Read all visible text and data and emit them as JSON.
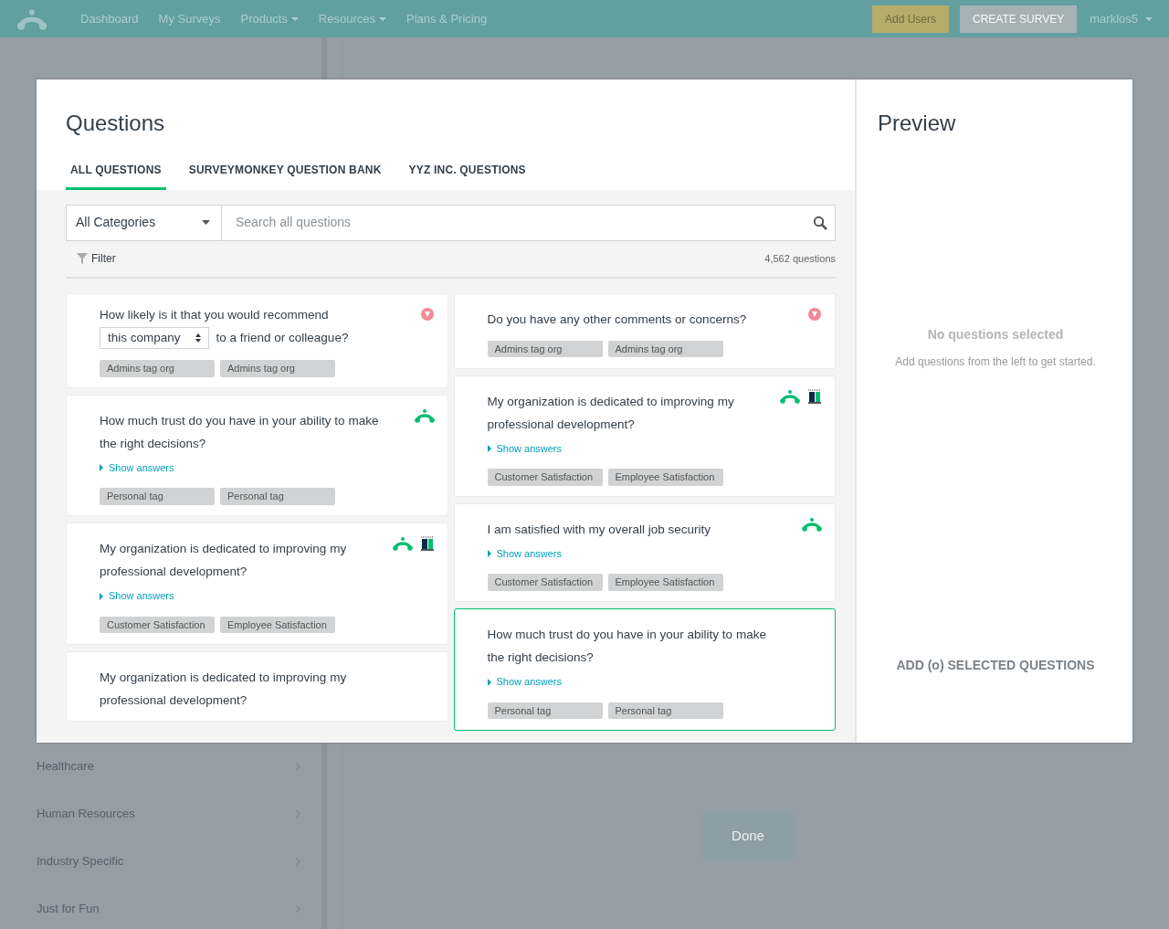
{
  "navbar": {
    "links": [
      {
        "label": "Dashboard",
        "dropdown": false
      },
      {
        "label": "My Surveys",
        "dropdown": false
      },
      {
        "label": "Products",
        "dropdown": true
      },
      {
        "label": "Resources",
        "dropdown": true
      },
      {
        "label": "Plans & Pricing",
        "dropdown": false
      }
    ],
    "add_users": "Add Users",
    "create_survey": "CREATE SURVEY",
    "user": "marklos5"
  },
  "background": {
    "categories": [
      "Healthcare",
      "Human Resources",
      "Industry Specific",
      "Just for Fun"
    ],
    "done": "Done"
  },
  "modal": {
    "title": "Questions",
    "tabs": [
      {
        "label": "ALL QUESTIONS",
        "selected": true
      },
      {
        "label": "SURVEYMONKEY QUESTION BANK",
        "selected": false
      },
      {
        "label": "YYZ INC. QUESTIONS",
        "selected": false
      }
    ],
    "category": "All Categories",
    "search": {
      "placeholder": "Search all questions"
    },
    "filter": "Filter",
    "count": "4,562 questions",
    "columns": [
      [
        {
          "kind": "org",
          "selected": false,
          "text": "How likely is it that you would recommend",
          "dropdown": "this company",
          "text_after": "to a friend or colleague?",
          "tags": [
            "Admins tag org",
            "Admins tag org"
          ]
        },
        {
          "kind": "bank",
          "selected": false,
          "text": "How much trust do you have in your ability to make the right decisions?",
          "show_answers": "Show answers",
          "tags": [
            "Personal tag",
            "Personal tag"
          ]
        },
        {
          "kind": "benchmark",
          "selected": false,
          "text": "My organization is dedicated to improving my professional development?",
          "show_answers": "Show answers",
          "tags": [
            "Customer Satisfaction",
            "Employee Satisfaction"
          ]
        },
        {
          "kind": "none",
          "selected": false,
          "text": "My organization is dedicated to improving my professional development?"
        }
      ],
      [
        {
          "kind": "org",
          "selected": false,
          "text": "Do you have any other comments or concerns?",
          "tags": [
            "Admins tag org",
            "Admins tag org"
          ]
        },
        {
          "kind": "benchmark",
          "selected": false,
          "text": "My organization is dedicated to improving my professional development?",
          "show_answers": "Show answers",
          "tags": [
            "Customer Satisfaction",
            "Employee Satisfaction"
          ]
        },
        {
          "kind": "bank",
          "selected": false,
          "text": "I am satisfied with my overall job security",
          "show_answers": "Show answers",
          "tags": [
            "Customer Satisfaction",
            "Employee Satisfaction"
          ]
        },
        {
          "kind": "none",
          "selected": true,
          "text": "How much trust do you have in your ability to make the right decisions?",
          "show_answers": "Show answers",
          "tags": [
            "Personal tag",
            "Personal tag"
          ]
        }
      ]
    ],
    "preview": {
      "title": "Preview",
      "empty_title": "No questions selected",
      "empty_text": "Add questions from the left to get started.",
      "add_button": "ADD (o) SELECTED QUESTIONS",
      "add_disabled": true
    }
  }
}
